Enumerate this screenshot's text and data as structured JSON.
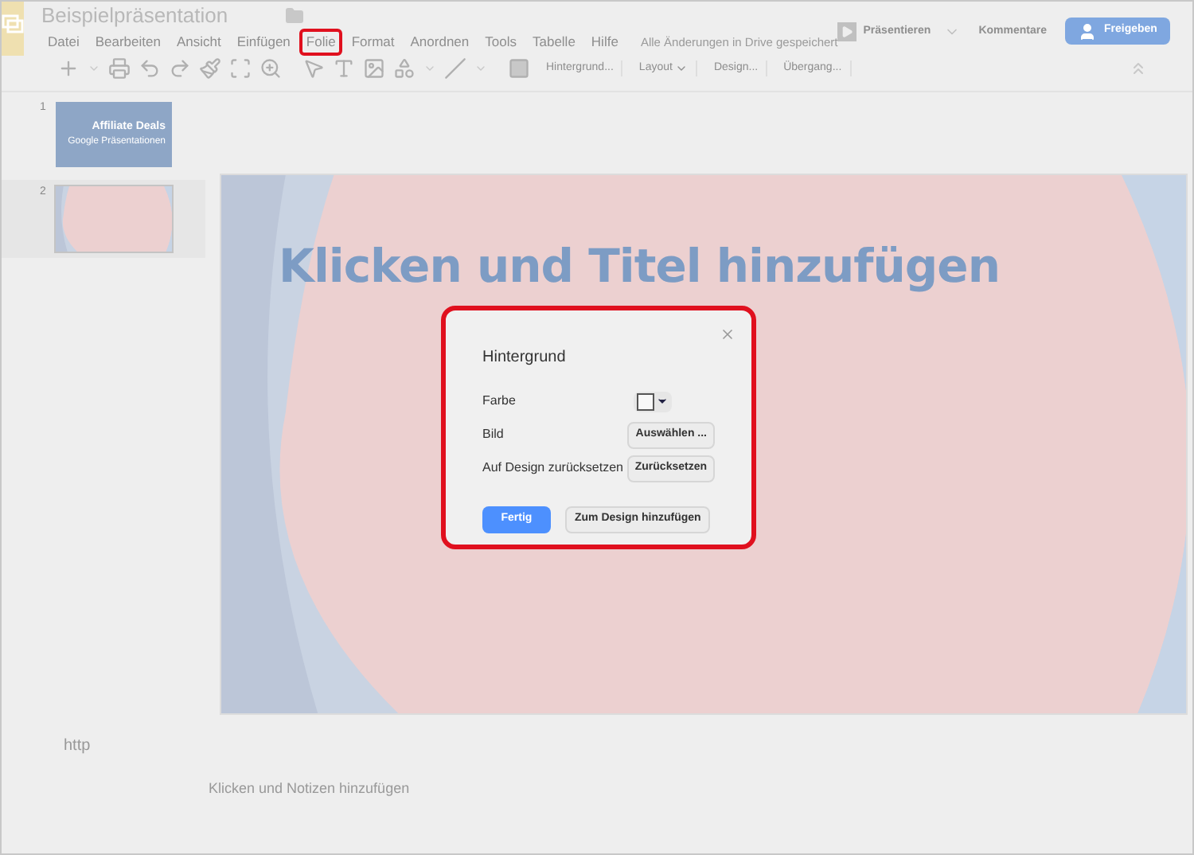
{
  "document": {
    "title": "Beispielpräsentation",
    "save_status": "Alle Änderungen in Drive gespeichert"
  },
  "menu": [
    {
      "label": "Datei",
      "highlighted": false
    },
    {
      "label": "Bearbeiten",
      "highlighted": false
    },
    {
      "label": "Ansicht",
      "highlighted": false
    },
    {
      "label": "Einfügen",
      "highlighted": false
    },
    {
      "label": "Folie",
      "highlighted": true
    },
    {
      "label": "Format",
      "highlighted": false
    },
    {
      "label": "Anordnen",
      "highlighted": false
    },
    {
      "label": "Tools",
      "highlighted": false
    },
    {
      "label": "Tabelle",
      "highlighted": false
    },
    {
      "label": "Hilfe",
      "highlighted": false
    }
  ],
  "actions": {
    "present": "Präsentieren",
    "comments": "Kommentare",
    "share": "Freigeben"
  },
  "toolbar_buttons": [
    {
      "label": "Hintergrund...",
      "dropdown": false
    },
    {
      "label": "Layout",
      "dropdown": true
    },
    {
      "label": "Design...",
      "dropdown": false
    },
    {
      "label": "Übergang...",
      "dropdown": false
    }
  ],
  "slides": [
    {
      "number": "1",
      "selected": false,
      "kind": "title",
      "title": "Affiliate Deals",
      "subtitle": "Google Präsentationen"
    },
    {
      "number": "2",
      "selected": true,
      "kind": "blank"
    }
  ],
  "slide": {
    "title_placeholder": "Klicken und Titel hinzufügen"
  },
  "notes": {
    "link_text": "http",
    "placeholder": "Klicken und Notizen hinzufügen"
  },
  "dialog": {
    "title": "Hintergrund",
    "highlighted": true,
    "rows": [
      {
        "label": "Farbe",
        "kind": "color"
      },
      {
        "label": "Bild",
        "kind": "button",
        "button": "Auswählen ..."
      },
      {
        "label": "Auf Design zurücksetzen",
        "kind": "button",
        "button": "Zurücksetzen"
      }
    ],
    "primary": "Fertig",
    "secondary": "Zum Design hinzufügen"
  }
}
